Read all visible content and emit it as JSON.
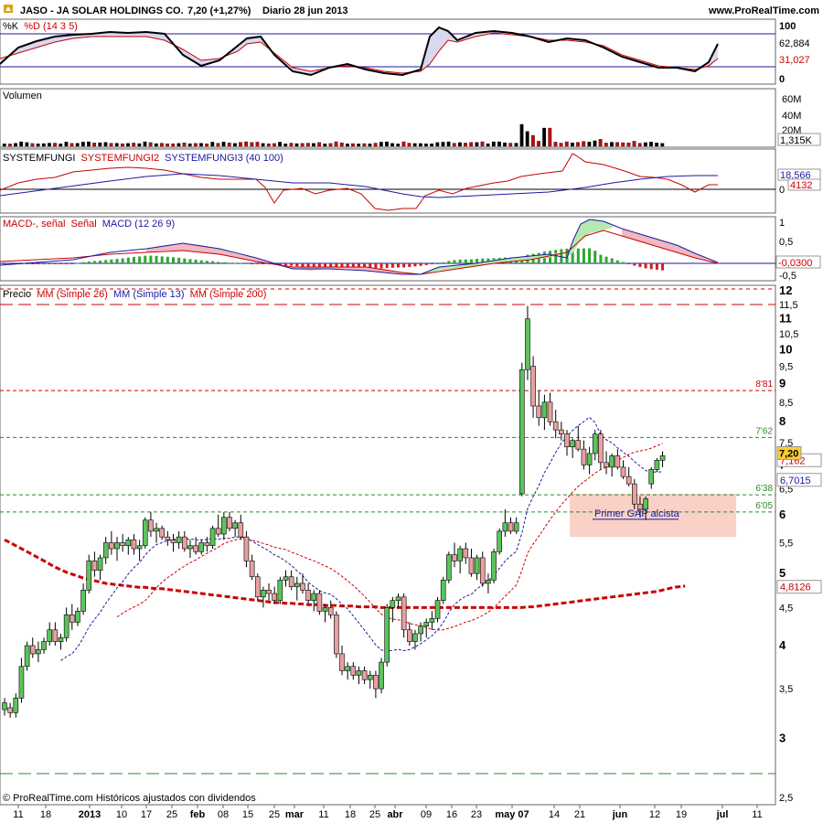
{
  "header": {
    "symbol": "JASO - JA SOLAR HOLDINGS CO.",
    "price": "7,20 (+1,27%)",
    "period": "Diario  28 jun 2013",
    "site": "www.ProRealTime.com"
  },
  "footer": {
    "credit": "© ProRealTime.com Históricos ajustados con dividendos"
  },
  "colors": {
    "up": "#5cc45c",
    "down": "#e8a0a0",
    "red": "#cc0000",
    "blue": "#1a1aa0",
    "green": "#2b8a2b",
    "zone": "#f9cfc4"
  },
  "panels": {
    "stoch": {
      "title_k": "%K",
      "title_d": "%D (14 3 5)",
      "axis": [
        "100",
        "0"
      ],
      "k_value": "62,884",
      "d_value": "31,027"
    },
    "volume": {
      "title": "Volumen",
      "axis": [
        "60M",
        "40M",
        "20M"
      ],
      "value": "1,315K"
    },
    "systemfungi": {
      "t1": "SYSTEMFUNGI",
      "t2": "SYSTEMFUNGI2",
      "t3": "SYSTEMFUNGI3 (40 100)",
      "v1": "18,566",
      "v2": "0",
      "v3": "4132"
    },
    "macd": {
      "t1": "MACD-, señal",
      "t2": "Señal",
      "t3": "MACD (12 26 9)",
      "axis": [
        "1",
        "0,5",
        "0",
        "-0,5"
      ],
      "value": "-0,0300"
    },
    "price": {
      "t1": "Precio",
      "t2": "MM (Simple 26)",
      "t3": "MM (Simple 13)",
      "t4": "MM (Simple 200)",
      "annotation": "Primer GAP alcista",
      "levels": [
        {
          "value": 8.81,
          "label": "8'81",
          "color": "#cc0000"
        },
        {
          "value": 7.62,
          "label": "7'62",
          "color": "#2b8a2b"
        },
        {
          "value": 6.38,
          "label": "6'38",
          "color": "#2b8a2b"
        },
        {
          "value": 6.05,
          "label": "6'05",
          "color": "#2b8a2b"
        }
      ],
      "badges": {
        "last": "7,20",
        "ma26": "7,162",
        "ma13": "6,7015",
        "ma200": "4,8126"
      }
    }
  },
  "chart_data": {
    "type": "candlestick",
    "title": "JASO - JA SOLAR HOLDINGS CO.",
    "ylim": [
      2.5,
      12
    ],
    "y_scale": "log",
    "y_ticks": [
      "12",
      "11,5",
      "11",
      "10,5",
      "10",
      "9,5",
      "9",
      "8,5",
      "8",
      "7,5",
      "7",
      "6,5",
      "6",
      "5,5",
      "5",
      "4,5",
      "4",
      "3,5",
      "3",
      "2,5"
    ],
    "x_ticks": [
      "11",
      "18",
      "2013",
      "10",
      "17",
      "25",
      "feb",
      "08",
      "15",
      "25",
      "mar",
      "11",
      "18",
      "25",
      "abr",
      "09",
      "16",
      "23",
      "may 07",
      "14",
      "21",
      "jun",
      "12",
      "19",
      "jul",
      "11"
    ],
    "candles": [
      [
        3.28,
        3.4,
        3.22,
        3.35
      ],
      [
        3.3,
        3.35,
        3.2,
        3.25
      ],
      [
        3.25,
        3.45,
        3.2,
        3.4
      ],
      [
        3.4,
        3.85,
        3.35,
        3.75
      ],
      [
        3.75,
        4.05,
        3.7,
        4.0
      ],
      [
        4.0,
        4.1,
        3.85,
        3.9
      ],
      [
        3.9,
        4.05,
        3.8,
        3.95
      ],
      [
        3.95,
        4.1,
        3.9,
        4.05
      ],
      [
        4.05,
        4.3,
        4.0,
        4.2
      ],
      [
        4.2,
        4.3,
        4.0,
        4.05
      ],
      [
        4.05,
        4.15,
        3.95,
        4.1
      ],
      [
        4.1,
        4.5,
        4.05,
        4.4
      ],
      [
        4.4,
        4.55,
        4.2,
        4.3
      ],
      [
        4.3,
        4.5,
        4.25,
        4.45
      ],
      [
        4.45,
        4.85,
        4.4,
        4.75
      ],
      [
        4.75,
        5.3,
        4.7,
        5.2
      ],
      [
        5.2,
        5.35,
        4.95,
        5.05
      ],
      [
        5.05,
        5.3,
        4.9,
        5.25
      ],
      [
        5.25,
        5.6,
        5.15,
        5.5
      ],
      [
        5.5,
        5.7,
        5.3,
        5.4
      ],
      [
        5.4,
        5.6,
        5.2,
        5.5
      ],
      [
        5.5,
        5.65,
        5.35,
        5.45
      ],
      [
        5.45,
        5.6,
        5.3,
        5.55
      ],
      [
        5.55,
        5.65,
        5.3,
        5.4
      ],
      [
        5.4,
        5.55,
        5.2,
        5.45
      ],
      [
        5.45,
        5.95,
        5.4,
        5.9
      ],
      [
        5.9,
        6.05,
        5.6,
        5.7
      ],
      [
        5.7,
        5.85,
        5.5,
        5.75
      ],
      [
        5.75,
        5.8,
        5.55,
        5.6
      ],
      [
        5.6,
        5.7,
        5.45,
        5.55
      ],
      [
        5.55,
        5.65,
        5.35,
        5.5
      ],
      [
        5.5,
        5.7,
        5.4,
        5.6
      ],
      [
        5.6,
        5.7,
        5.35,
        5.4
      ],
      [
        5.4,
        5.55,
        5.25,
        5.45
      ],
      [
        5.45,
        5.6,
        5.3,
        5.35
      ],
      [
        5.35,
        5.55,
        5.3,
        5.5
      ],
      [
        5.5,
        5.6,
        5.35,
        5.45
      ],
      [
        5.45,
        5.8,
        5.4,
        5.75
      ],
      [
        5.75,
        6.0,
        5.6,
        5.65
      ],
      [
        5.65,
        6.05,
        5.55,
        5.95
      ],
      [
        5.95,
        6.05,
        5.7,
        5.75
      ],
      [
        5.75,
        5.9,
        5.6,
        5.85
      ],
      [
        5.85,
        6.0,
        5.55,
        5.6
      ],
      [
        5.6,
        5.7,
        5.1,
        5.2
      ],
      [
        5.2,
        5.3,
        4.9,
        4.95
      ],
      [
        4.95,
        5.0,
        4.6,
        4.65
      ],
      [
        4.65,
        4.8,
        4.5,
        4.75
      ],
      [
        4.75,
        4.85,
        4.6,
        4.7
      ],
      [
        4.7,
        4.8,
        4.55,
        4.6
      ],
      [
        4.6,
        4.95,
        4.55,
        4.9
      ],
      [
        4.9,
        5.05,
        4.8,
        4.95
      ],
      [
        4.95,
        5.05,
        4.75,
        4.8
      ],
      [
        4.8,
        4.95,
        4.6,
        4.85
      ],
      [
        4.85,
        5.0,
        4.7,
        4.75
      ],
      [
        4.75,
        4.85,
        4.55,
        4.6
      ],
      [
        4.6,
        4.75,
        4.45,
        4.7
      ],
      [
        4.7,
        4.75,
        4.4,
        4.45
      ],
      [
        4.45,
        4.55,
        4.3,
        4.5
      ],
      [
        4.5,
        4.6,
        4.35,
        4.4
      ],
      [
        4.4,
        4.45,
        3.85,
        3.9
      ],
      [
        3.9,
        4.0,
        3.65,
        3.7
      ],
      [
        3.7,
        3.8,
        3.6,
        3.75
      ],
      [
        3.75,
        3.8,
        3.6,
        3.65
      ],
      [
        3.65,
        3.75,
        3.55,
        3.7
      ],
      [
        3.7,
        3.75,
        3.55,
        3.6
      ],
      [
        3.6,
        3.7,
        3.5,
        3.65
      ],
      [
        3.65,
        3.7,
        3.4,
        3.5
      ],
      [
        3.5,
        3.85,
        3.45,
        3.8
      ],
      [
        3.8,
        4.55,
        3.75,
        4.5
      ],
      [
        4.5,
        4.65,
        4.3,
        4.6
      ],
      [
        4.6,
        4.7,
        4.5,
        4.65
      ],
      [
        4.65,
        4.7,
        4.1,
        4.2
      ],
      [
        4.2,
        4.3,
        4.0,
        4.05
      ],
      [
        4.05,
        4.2,
        3.95,
        4.15
      ],
      [
        4.15,
        4.3,
        4.05,
        4.25
      ],
      [
        4.25,
        4.35,
        4.1,
        4.3
      ],
      [
        4.3,
        4.45,
        4.2,
        4.35
      ],
      [
        4.35,
        4.65,
        4.3,
        4.6
      ],
      [
        4.6,
        4.95,
        4.55,
        4.9
      ],
      [
        4.9,
        5.35,
        4.85,
        5.3
      ],
      [
        5.3,
        5.5,
        5.1,
        5.2
      ],
      [
        5.2,
        5.45,
        5.0,
        5.4
      ],
      [
        5.4,
        5.5,
        5.15,
        5.25
      ],
      [
        5.25,
        5.4,
        4.95,
        5.0
      ],
      [
        5.0,
        5.3,
        4.9,
        5.25
      ],
      [
        5.25,
        5.35,
        4.8,
        4.85
      ],
      [
        4.85,
        5.0,
        4.7,
        4.9
      ],
      [
        4.9,
        5.4,
        4.85,
        5.35
      ],
      [
        5.35,
        5.75,
        5.3,
        5.7
      ],
      [
        5.7,
        6.1,
        5.6,
        5.85
      ],
      [
        5.85,
        5.95,
        5.65,
        5.7
      ],
      [
        5.7,
        5.95,
        5.65,
        5.85
      ],
      [
        6.4,
        9.6,
        6.35,
        9.4
      ],
      [
        9.4,
        11.45,
        9.1,
        11.0
      ],
      [
        9.5,
        9.8,
        8.1,
        8.4
      ],
      [
        8.4,
        8.8,
        7.9,
        8.1
      ],
      [
        8.1,
        8.7,
        7.8,
        8.5
      ],
      [
        8.5,
        8.75,
        7.9,
        8.0
      ],
      [
        8.0,
        8.3,
        7.6,
        7.8
      ],
      [
        7.8,
        8.0,
        7.55,
        7.7
      ],
      [
        7.7,
        7.8,
        7.2,
        7.4
      ],
      [
        7.4,
        7.6,
        7.15,
        7.55
      ],
      [
        7.55,
        7.9,
        7.3,
        7.35
      ],
      [
        7.35,
        7.55,
        6.9,
        7.0
      ],
      [
        7.0,
        7.4,
        6.8,
        7.25
      ],
      [
        7.25,
        7.8,
        7.1,
        7.7
      ],
      [
        7.7,
        7.8,
        6.9,
        7.05
      ],
      [
        7.05,
        7.3,
        6.8,
        6.95
      ],
      [
        6.95,
        7.25,
        6.75,
        7.2
      ],
      [
        7.2,
        7.35,
        6.9,
        6.95
      ],
      [
        6.95,
        7.1,
        6.7,
        6.75
      ],
      [
        6.75,
        6.95,
        6.55,
        6.6
      ],
      [
        6.6,
        6.7,
        6.1,
        6.2
      ],
      [
        6.2,
        6.35,
        5.95,
        6.1
      ],
      [
        6.1,
        6.35,
        5.9,
        6.3
      ],
      [
        6.6,
        6.95,
        6.5,
        6.9
      ],
      [
        6.9,
        7.15,
        6.85,
        7.1
      ],
      [
        7.1,
        7.3,
        6.95,
        7.2
      ]
    ],
    "ma200": [
      5.55,
      5.5,
      5.45,
      5.4,
      5.35,
      5.3,
      5.25,
      5.2,
      5.15,
      5.1,
      5.06,
      5.02,
      4.99,
      4.96,
      4.93,
      4.91,
      4.89,
      4.87,
      4.85,
      4.84,
      4.83,
      4.82,
      4.81,
      4.8,
      4.79,
      4.79,
      4.78,
      4.77,
      4.77,
      4.76,
      4.75,
      4.74,
      4.73,
      4.72,
      4.71,
      4.7,
      4.69,
      4.68,
      4.67,
      4.66,
      4.65,
      4.64,
      4.63,
      4.62,
      4.61,
      4.6,
      4.59,
      4.58,
      4.57,
      4.57,
      4.56,
      4.56,
      4.55,
      4.55,
      4.54,
      4.54,
      4.54,
      4.53,
      4.53,
      4.53,
      4.52,
      4.52,
      4.52,
      4.51,
      4.51,
      4.51,
      4.51,
      4.5,
      4.5,
      4.5,
      4.5,
      4.5,
      4.5,
      4.5,
      4.5,
      4.5,
      4.5,
      4.5,
      4.5,
      4.5,
      4.5,
      4.5,
      4.5,
      4.5,
      4.5,
      4.5,
      4.5,
      4.5,
      4.5,
      4.5,
      4.5,
      4.5,
      4.5,
      4.51,
      4.51,
      4.52,
      4.53,
      4.54,
      4.55,
      4.56,
      4.57,
      4.58,
      4.59,
      4.6,
      4.61,
      4.62,
      4.63,
      4.64,
      4.65,
      4.66,
      4.67,
      4.68,
      4.69,
      4.7,
      4.71,
      4.72,
      4.73,
      4.75,
      4.77,
      4.79,
      4.8,
      4.81
    ]
  }
}
